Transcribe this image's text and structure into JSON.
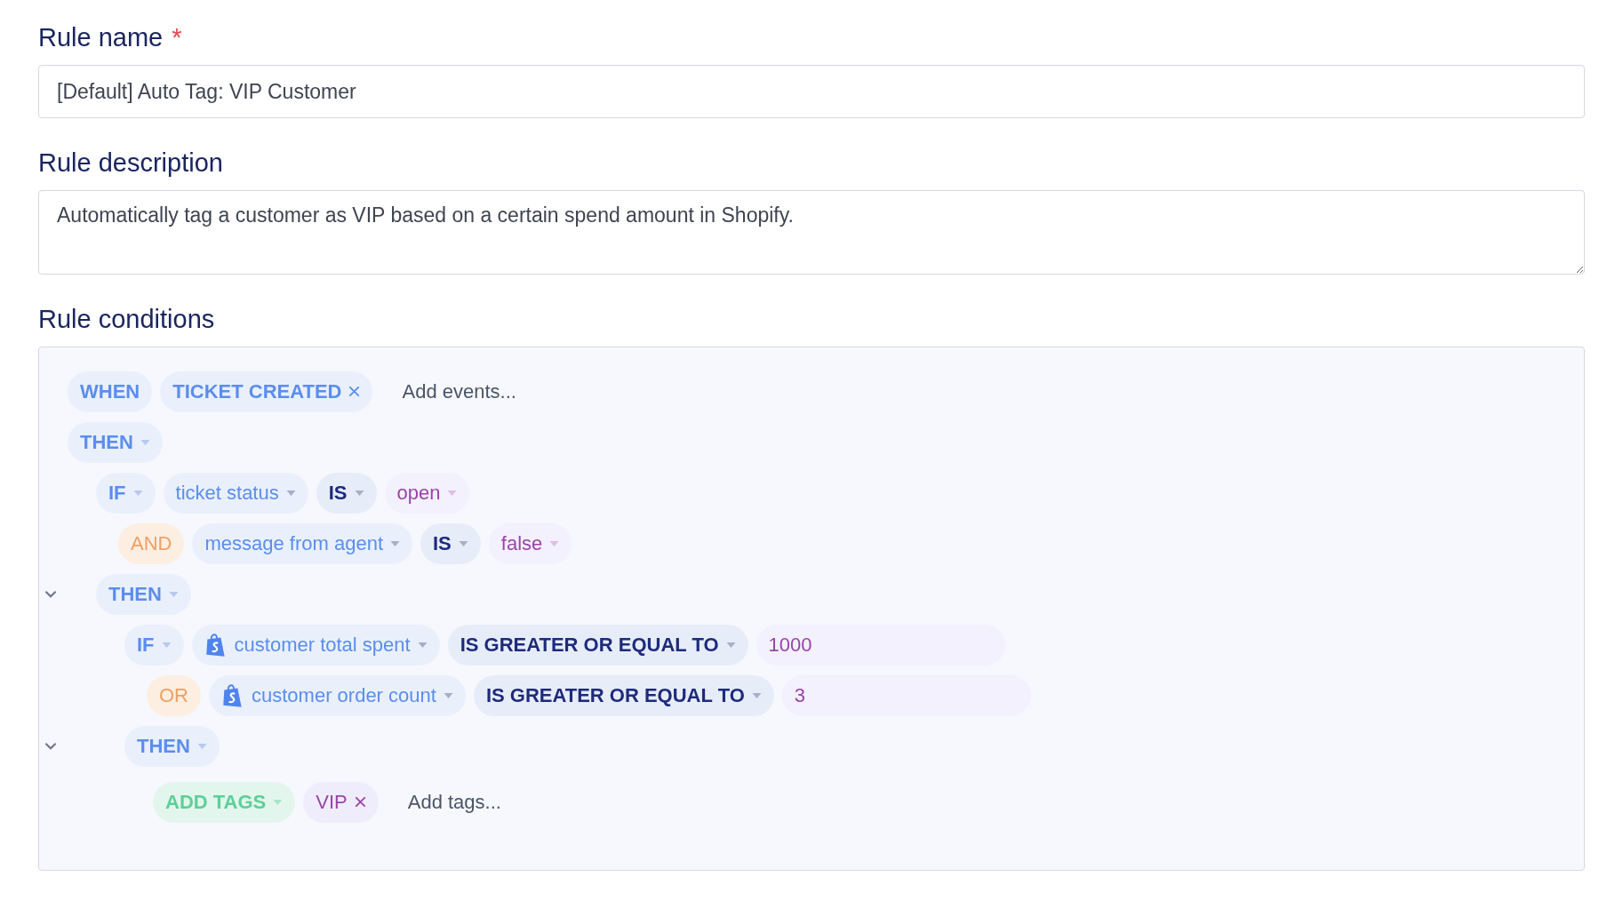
{
  "rule_name": {
    "label": "Rule name",
    "required_mark": "*",
    "value": "[Default] Auto Tag: VIP Customer"
  },
  "rule_description": {
    "label": "Rule description",
    "value": "Automatically tag a customer as VIP based on a certain spend amount in Shopify."
  },
  "rule_conditions": {
    "label": "Rule conditions",
    "flow": [
      {
        "kind": "trigger",
        "tokens": [
          {
            "kind": "keyword",
            "text": "WHEN"
          },
          {
            "kind": "event",
            "text": "TICKET CREATED",
            "removable": true
          },
          {
            "kind": "add",
            "text": "Add events..."
          }
        ]
      },
      {
        "kind": "then",
        "tokens": [
          {
            "kind": "keyword",
            "text": "THEN",
            "dropdown": true
          }
        ],
        "children": [
          {
            "kind": "condition",
            "tokens": [
              {
                "kind": "keyword",
                "text": "IF",
                "dropdown": true
              },
              {
                "kind": "field",
                "text": "ticket status",
                "dropdown": true
              },
              {
                "kind": "comparator",
                "text": "IS",
                "dropdown": true
              },
              {
                "kind": "value",
                "text": "open",
                "dropdown": true
              }
            ],
            "children": [
              {
                "kind": "condition",
                "tokens": [
                  {
                    "kind": "and",
                    "text": "AND"
                  },
                  {
                    "kind": "field",
                    "text": "message from agent",
                    "dropdown": true
                  },
                  {
                    "kind": "comparator",
                    "text": "IS",
                    "dropdown": true
                  },
                  {
                    "kind": "value",
                    "text": "false",
                    "dropdown": true
                  }
                ]
              }
            ]
          },
          {
            "kind": "then",
            "expanded": true,
            "tokens": [
              {
                "kind": "keyword",
                "text": "THEN",
                "dropdown": true
              }
            ],
            "children": [
              {
                "kind": "condition",
                "tokens": [
                  {
                    "kind": "keyword",
                    "text": "IF",
                    "dropdown": true
                  },
                  {
                    "kind": "field",
                    "text": "customer total spent",
                    "dropdown": true,
                    "icon": true
                  },
                  {
                    "kind": "comparator",
                    "text": "IS GREATER OR EQUAL TO",
                    "dropdown": true
                  },
                  {
                    "kind": "value",
                    "text": "1000"
                  }
                ],
                "children": [
                  {
                    "kind": "condition",
                    "tokens": [
                      {
                        "kind": "and",
                        "text": "OR"
                      },
                      {
                        "kind": "field",
                        "text": "customer order count",
                        "dropdown": true,
                        "icon": true
                      },
                      {
                        "kind": "comparator",
                        "text": "IS GREATER OR EQUAL TO",
                        "dropdown": true
                      },
                      {
                        "kind": "value",
                        "text": "3"
                      }
                    ]
                  }
                ]
              },
              {
                "kind": "then",
                "expanded": true,
                "tokens": [
                  {
                    "kind": "keyword",
                    "text": "THEN",
                    "dropdown": true
                  }
                ],
                "children": [
                  {
                    "kind": "action",
                    "tokens": [
                      {
                        "kind": "action",
                        "text": "ADD TAGS",
                        "dropdown": true
                      },
                      {
                        "kind": "tag",
                        "text": "VIP",
                        "removable": true
                      },
                      {
                        "kind": "add",
                        "text": "Add tags..."
                      }
                    ]
                  }
                ]
              }
            ]
          }
        ]
      }
    ]
  }
}
